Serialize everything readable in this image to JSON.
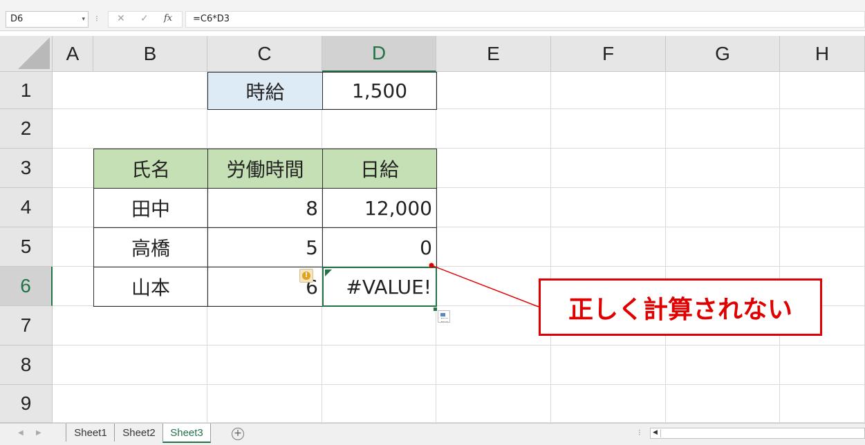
{
  "formula_bar": {
    "name_box": "D6",
    "dropdown_glyph": "▾",
    "separator_glyph": "⁝",
    "cancel_glyph": "✕",
    "enter_glyph": "✓",
    "fx_glyph": "fx",
    "formula": "=C6*D3"
  },
  "columns": [
    "A",
    "B",
    "C",
    "D",
    "E",
    "F",
    "G",
    "H"
  ],
  "active_column": "D",
  "rows": [
    "1",
    "2",
    "3",
    "4",
    "5",
    "6",
    "7",
    "8",
    "9"
  ],
  "active_row": "6",
  "cells": {
    "C1": "時給",
    "D1": "1,500",
    "B3": "氏名",
    "C3": "労働時間",
    "D3": "日給",
    "B4": "田中",
    "C4": "8",
    "D4": "12,000",
    "B5": "高橋",
    "C5": "5",
    "D5": "0",
    "B6": "山本",
    "C6": "6",
    "D6": "#VALUE!"
  },
  "warning_glyph": "!",
  "annotation": {
    "text": "正しく計算されない",
    "color": "#e00000"
  },
  "sheet_tabs": [
    "Sheet1",
    "Sheet2",
    "Sheet3"
  ],
  "active_sheet": "Sheet3",
  "add_sheet_glyph": "+",
  "nav_left_glyph": "◀",
  "nav_right_glyph": "▶",
  "scroll_left_glyph": "◀",
  "tab_separator_glyph": "⁝",
  "colors": {
    "accent": "#217346",
    "header_green": "#c5e0b4",
    "header_blue": "#ddebf7"
  }
}
